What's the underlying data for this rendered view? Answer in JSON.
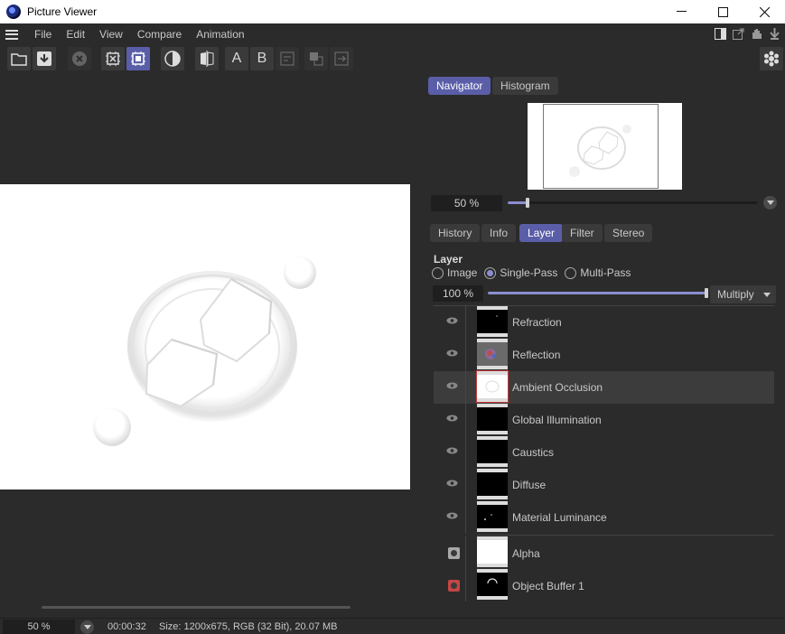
{
  "window": {
    "title": "Picture Viewer",
    "controls": [
      "minimize",
      "maximize",
      "close"
    ]
  },
  "menu": {
    "items": [
      "File",
      "Edit",
      "View",
      "Compare",
      "Animation"
    ]
  },
  "toolbar": {
    "buttons": [
      {
        "icon": "open-folder-icon"
      },
      {
        "icon": "save-download-icon"
      },
      {
        "icon": "stop-icon"
      },
      {
        "icon": "region-render-icon"
      },
      {
        "icon": "interactive-render-icon",
        "active": true
      },
      {
        "icon": "contrast-icon"
      },
      {
        "icon": "ab-compare-icon"
      },
      {
        "icon": "a-label",
        "text": "A"
      },
      {
        "icon": "b-label",
        "text": "B"
      },
      {
        "icon": "compare-text-icon"
      },
      {
        "icon": "copy-layer-icon"
      },
      {
        "icon": "export-icon"
      }
    ]
  },
  "right_panel": {
    "top_tabs": [
      {
        "label": "Navigator",
        "active": true
      },
      {
        "label": "Histogram",
        "active": false
      }
    ],
    "navigator_zoom": "50 %",
    "navigator_zoom_level": 0.08,
    "sub_tabs": [
      {
        "label": "History",
        "active": false
      },
      {
        "label": "Info",
        "active": false
      },
      {
        "label": "Layer",
        "active": true
      },
      {
        "label": "Filter",
        "active": false
      },
      {
        "label": "Stereo",
        "active": false
      }
    ],
    "layer_section": {
      "title": "Layer",
      "modes": [
        {
          "label": "Image",
          "checked": false
        },
        {
          "label": "Single-Pass",
          "checked": true
        },
        {
          "label": "Multi-Pass",
          "checked": false
        }
      ],
      "opacity": "100 %",
      "opacity_level": 1.0,
      "blend_mode": "Multiply",
      "layers": [
        {
          "name": "Refraction",
          "icon": "eye-icon",
          "selected": false
        },
        {
          "name": "Reflection",
          "icon": "eye-icon",
          "selected": false
        },
        {
          "name": "Ambient Occlusion",
          "icon": "eye-icon",
          "selected": true
        },
        {
          "name": "Global Illumination",
          "icon": "eye-icon",
          "selected": false
        },
        {
          "name": "Caustics",
          "icon": "eye-icon",
          "selected": false
        },
        {
          "name": "Diffuse",
          "icon": "eye-icon",
          "selected": false
        },
        {
          "name": "Material Luminance",
          "icon": "eye-icon",
          "selected": false
        },
        {
          "name": "Alpha",
          "icon": "alpha-channel-icon",
          "selected": false
        },
        {
          "name": "Object Buffer 1",
          "icon": "object-buffer-icon",
          "selected": false
        }
      ]
    }
  },
  "status": {
    "zoom": "50 %",
    "time": "00:00:32",
    "info": "Size: 1200x675, RGB (32 Bit), 20.07 MB"
  },
  "colors": {
    "background": "#2b2b2b",
    "accent": "#5a5ea8",
    "object_buffer": "#c44545"
  }
}
